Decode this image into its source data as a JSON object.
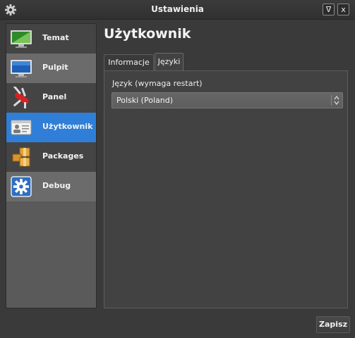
{
  "window": {
    "title": "Ustawienia",
    "shade_button": "∇",
    "close_button": "x"
  },
  "sidebar": {
    "items": [
      {
        "label": "Temat",
        "icon": "theme-monitor-icon"
      },
      {
        "label": "Pulpit",
        "icon": "desktop-monitor-icon"
      },
      {
        "label": "Panel",
        "icon": "swiss-knife-icon"
      },
      {
        "label": "Użytkownik",
        "icon": "id-card-icon",
        "selected": true
      },
      {
        "label": "Packages",
        "icon": "packages-icon"
      },
      {
        "label": "Debug",
        "icon": "gear-icon"
      }
    ]
  },
  "main": {
    "title": "Użytkownik",
    "tabs": [
      {
        "label": "Informacje"
      },
      {
        "label": "Języki",
        "active": true
      }
    ],
    "language_field": {
      "label": "Język (wymaga restart)",
      "value": "Polski (Poland)"
    }
  },
  "footer": {
    "save_label": "Zapisz"
  },
  "colors": {
    "accent": "#2f7fd8",
    "background": "#3a3a3a",
    "panel": "#424242"
  }
}
